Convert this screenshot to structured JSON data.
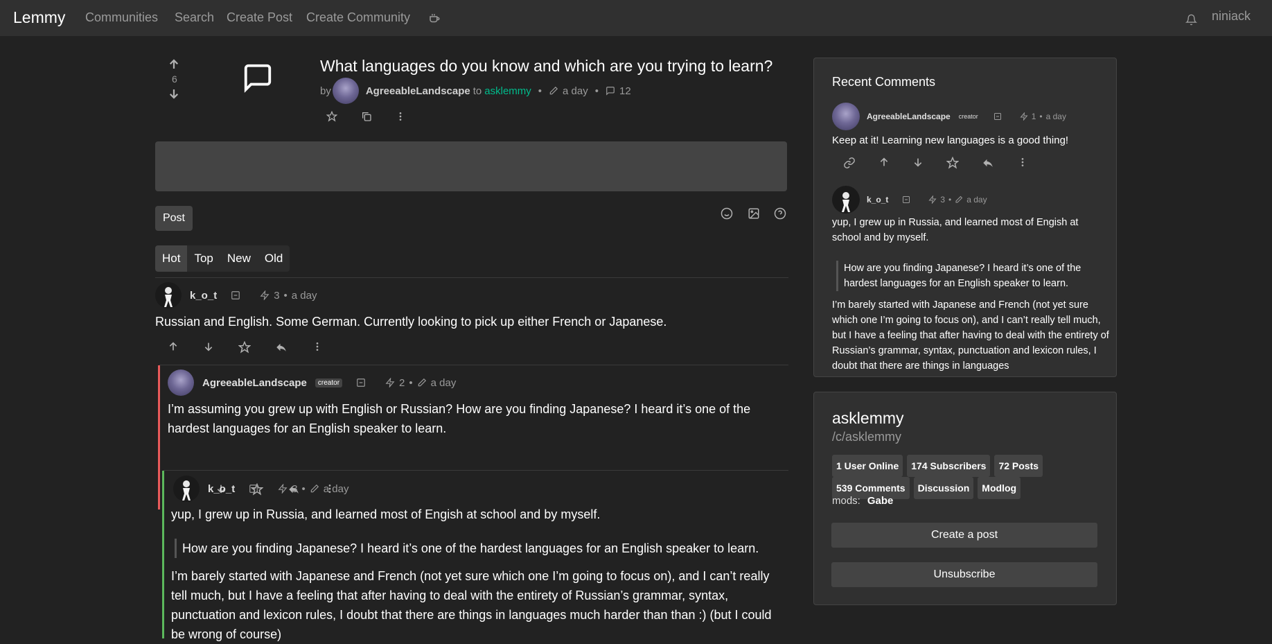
{
  "nav": {
    "brand": "Lemmy",
    "links": [
      "Communities",
      "Search",
      "Create Post",
      "Create Community"
    ],
    "username": "niniack"
  },
  "post": {
    "score": "6",
    "title": "What languages do you know and which are you trying to learn?",
    "by": "by",
    "author": "AgreeableLandscape",
    "to": "to",
    "community": "asklemmy",
    "time": "a day",
    "comments": "12"
  },
  "composer": {
    "post_label": "Post"
  },
  "sort": [
    "Hot",
    "Top",
    "New",
    "Old"
  ],
  "comments": [
    {
      "author": "k_o_t",
      "score": "3",
      "time": "a day",
      "text": "Russian and English. Some German. Currently looking to pick up either French or Japanese."
    },
    {
      "author": "AgreeableLandscape",
      "badge": "creator",
      "score": "2",
      "time": "a day",
      "text": "I’m assuming you grew up with English or Russian? How are you finding Japanese? I heard it’s one of the hardest languages for an English speaker to learn."
    },
    {
      "author": "k_o_t",
      "score": "3",
      "time": "a day",
      "text": "yup, I grew up in Russia, and learned most of Engish at school and by myself.",
      "quote": "How are you finding Japanese? I heard it’s one of the hardest languages for an English speaker to learn.",
      "text2": "I’m barely started with Japanese and French (not yet sure which one I’m going to focus on), and I can’t really tell much, but I have a feeling that after having to deal with the entirety of Russian’s grammar, syntax, punctuation and lexicon rules, I doubt that there are things in languages much harder than than :) (but I could be wrong of course)"
    }
  ],
  "recent": {
    "title": "Recent Comments",
    "c1": {
      "author": "AgreeableLandscape",
      "badge": "creator",
      "score": "1",
      "time": "a day",
      "text": "Keep at it! Learning new languages is a good thing!"
    },
    "c2": {
      "author": "k_o_t",
      "score": "3",
      "time": "a day",
      "text": "yup, I grew up in Russia, and learned most of Engish at school and by myself.",
      "quote": "How are you finding Japanese? I heard it’s one of the hardest languages for an English speaker to learn.",
      "text2": "I’m barely started with Japanese and French (not yet sure which one I’m going to focus on), and I can’t really tell much, but I have a feeling that after having to deal with the entirety of Russian’s grammar, syntax, punctuation and lexicon rules, I doubt that there are things in languages"
    }
  },
  "community": {
    "name": "asklemmy",
    "path": "/c/asklemmy",
    "stats": [
      "1 User Online",
      "174 Subscribers",
      "72 Posts",
      "539 Comments",
      "Discussion",
      "Modlog"
    ],
    "mods_label": "mods:",
    "mod": "Gabe",
    "create_post": "Create a post",
    "unsubscribe": "Unsubscribe"
  },
  "colors": {
    "bg": "#222222",
    "navbar": "#303030",
    "accent_green": "#00bc8c",
    "thread_red": "#e85a5a",
    "thread_green": "#5cb85c"
  }
}
